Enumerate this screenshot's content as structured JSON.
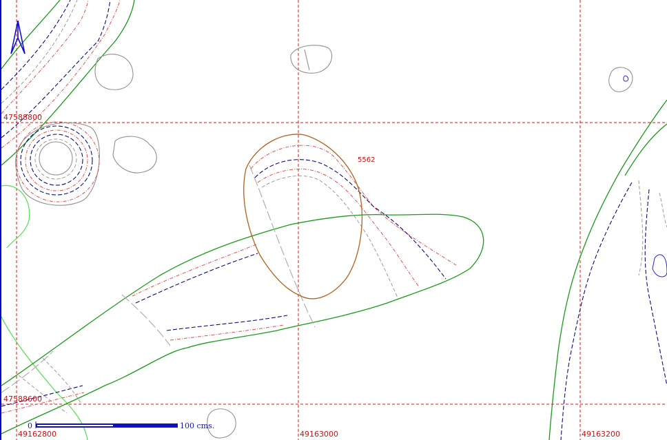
{
  "window": {
    "title": ""
  },
  "grid": {
    "northings": [
      {
        "label": "47588800"
      },
      {
        "label": "47588600"
      }
    ],
    "eastings": [
      {
        "label": "49162800"
      },
      {
        "label": "49163000"
      },
      {
        "label": "49163200"
      }
    ]
  },
  "contour_label": "5562",
  "scale_bar": {
    "start_label": "0",
    "end_label": "100 cms."
  },
  "north_arrow": {
    "icon": "north-arrow-icon"
  },
  "colors": {
    "grid": "#e01010",
    "watercourse": "#1a9a1a",
    "contour_major": "#0a0a80",
    "contour_minor": "#e05050",
    "feature_outline": "#909090",
    "highlight_polygon": "#b0601c",
    "scale_bar": "#1010c0"
  }
}
